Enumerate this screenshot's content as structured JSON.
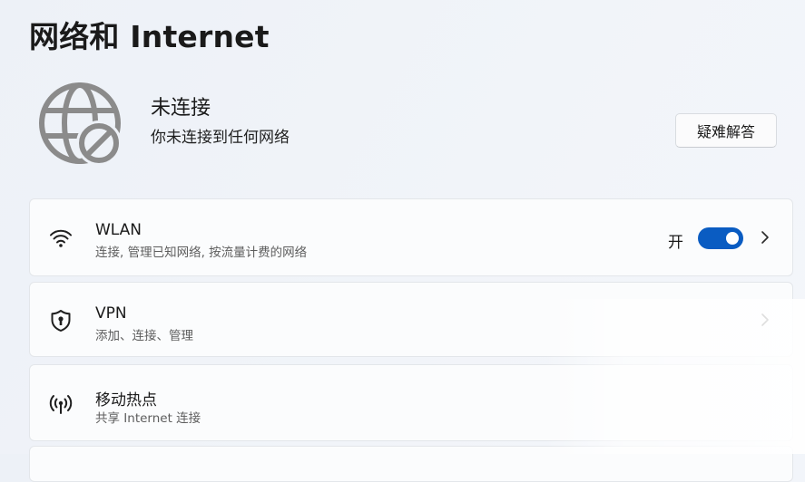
{
  "page": {
    "title": "网络和 Internet"
  },
  "status": {
    "title": "未连接",
    "subtitle": "你未连接到任何网络",
    "icon": "globe-disconnected-icon",
    "troubleshoot_label": "疑难解答"
  },
  "cards": {
    "wlan": {
      "icon": "wifi-icon",
      "title": "WLAN",
      "description": "连接, 管理已知网络, 按流量计费的网络",
      "toggle_label": "开",
      "toggle_on": true
    },
    "vpn": {
      "icon": "shield-icon",
      "title": "VPN",
      "description": "添加、连接、管理"
    },
    "hotspot": {
      "icon": "hotspot-icon",
      "title": "移动热点",
      "description": "共享 Internet 连接"
    }
  },
  "colors": {
    "accent": "#0a5cc2",
    "background": "#eef2f7",
    "card": "#fbfcfd"
  }
}
